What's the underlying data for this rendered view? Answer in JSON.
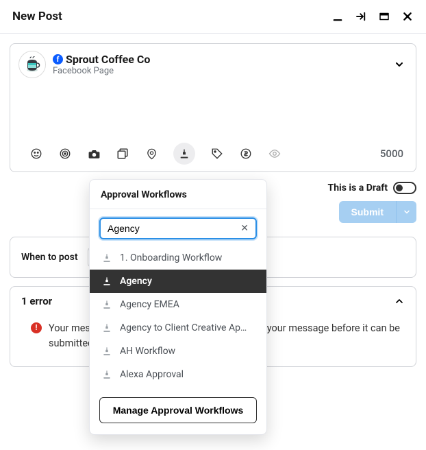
{
  "header": {
    "title": "New Post"
  },
  "profile": {
    "name": "Sprout Coffee Co",
    "subtitle": "Facebook Page",
    "network_icon": "facebook"
  },
  "composer": {
    "char_count": "5000"
  },
  "draft": {
    "label": "This is a Draft",
    "toggle_on": false
  },
  "submit": {
    "label": "Submit"
  },
  "when": {
    "label": "When to post"
  },
  "error": {
    "title": "1 error",
    "message": "Your message is empty. You must add content to your message before it can be submitted for approval."
  },
  "approval": {
    "title": "Approval Workflows",
    "search_value": "Agency",
    "items": [
      {
        "label": "1. Onboarding Workflow",
        "active": false
      },
      {
        "label": "Agency",
        "active": true
      },
      {
        "label": "Agency EMEA",
        "active": false
      },
      {
        "label": "Agency to Client Creative Ap…",
        "active": false
      },
      {
        "label": "AH Workflow",
        "active": false
      },
      {
        "label": "Alexa Approval",
        "active": false
      }
    ],
    "manage_label": "Manage Approval Workflows"
  }
}
